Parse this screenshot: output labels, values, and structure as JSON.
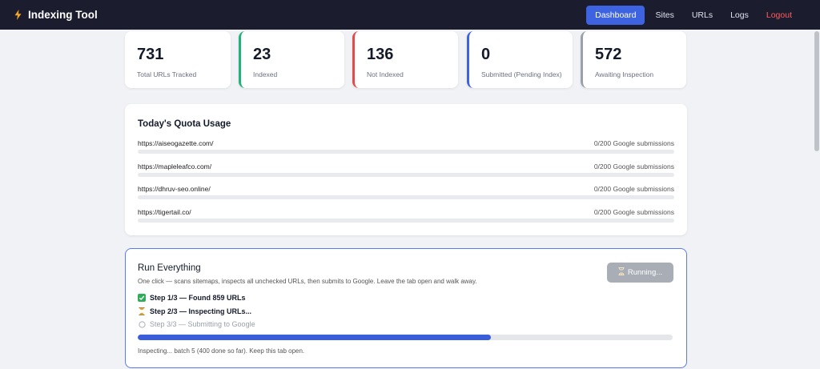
{
  "app": {
    "title": "Indexing Tool",
    "accent_color": "#3e63e0"
  },
  "nav": {
    "items": [
      {
        "label": "Dashboard",
        "active": true
      },
      {
        "label": "Sites",
        "active": false
      },
      {
        "label": "URLs",
        "active": false
      },
      {
        "label": "Logs",
        "active": false
      },
      {
        "label": "Logout",
        "active": false
      }
    ]
  },
  "stats": [
    {
      "value": "731",
      "label": "Total URLs Tracked",
      "color": "none"
    },
    {
      "value": "23",
      "label": "Indexed",
      "color": "#20b27a"
    },
    {
      "value": "136",
      "label": "Not Indexed",
      "color": "#e04b4b"
    },
    {
      "value": "0",
      "label": "Submitted (Pending Index)",
      "color": "#3e63e0"
    },
    {
      "value": "572",
      "label": "Awaiting Inspection",
      "color": "#9aa0ab"
    }
  ],
  "quota": {
    "title": "Today's Quota Usage",
    "rows": [
      {
        "site": "https://aiseogazette.com/",
        "count": "0/200 Google submissions",
        "fraction": 0
      },
      {
        "site": "https://mapleleafco.com/",
        "count": "0/200 Google submissions",
        "fraction": 0
      },
      {
        "site": "https://dhruv-seo.online/",
        "count": "0/200 Google submissions",
        "fraction": 0
      },
      {
        "site": "https://tigertail.co/",
        "count": "0/200 Google submissions",
        "fraction": 0
      }
    ]
  },
  "run": {
    "title": "Run Everything",
    "description": "One click — scans sitemaps, inspects all unchecked URLs, then submits to Google. Leave the tab open and walk away.",
    "button_label": "Running...",
    "button_icon": "hourglass-icon",
    "steps": [
      {
        "label": "Step 1/3 — Found 859 URLs",
        "state": "done",
        "icon": "check-icon"
      },
      {
        "label": "Step 2/3 — Inspecting URLs...",
        "state": "active",
        "icon": "hourglass-icon"
      },
      {
        "label": "Step 3/3 — Submitting to Google",
        "state": "pending",
        "icon": "circle-icon"
      }
    ],
    "progress_percent": 66,
    "status": "Inspecting... batch 5 (400 done so far). Keep this tab open."
  }
}
